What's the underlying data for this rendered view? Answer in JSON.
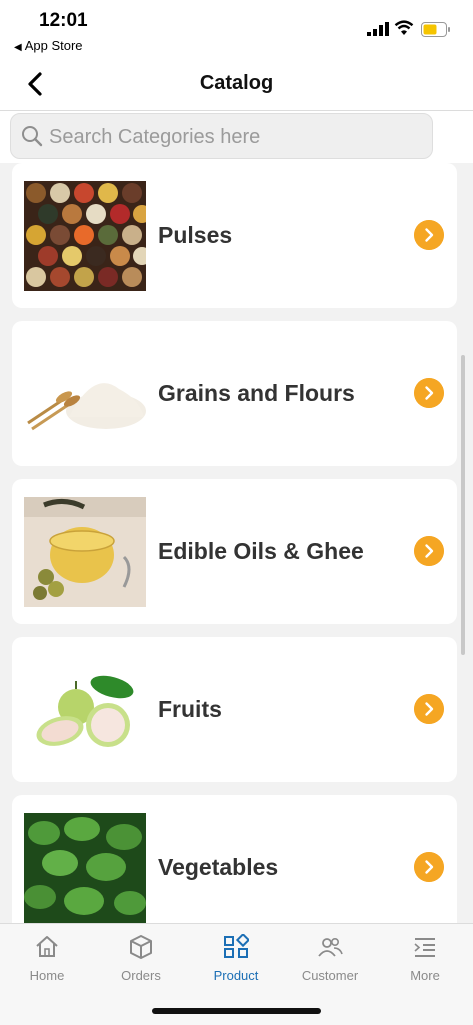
{
  "status": {
    "time": "12:01",
    "back_app": "App Store"
  },
  "nav": {
    "title": "Catalog"
  },
  "search": {
    "placeholder": "Search Categories here"
  },
  "categories": [
    {
      "label": "Pulses",
      "image": "pulses-image"
    },
    {
      "label": "Grains and Flours",
      "image": "grains-image"
    },
    {
      "label": "Edible Oils & Ghee",
      "image": "oils-image"
    },
    {
      "label": "Fruits",
      "image": "fruits-image"
    },
    {
      "label": "Vegetables",
      "image": "vegetables-image"
    }
  ],
  "tabs": [
    {
      "label": "Home",
      "icon": "home-icon",
      "active": false
    },
    {
      "label": "Orders",
      "icon": "box-icon",
      "active": false
    },
    {
      "label": "Product",
      "icon": "grid-icon",
      "active": true
    },
    {
      "label": "Customer",
      "icon": "users-icon",
      "active": false
    },
    {
      "label": "More",
      "icon": "menu-icon",
      "active": false
    }
  ],
  "colors": {
    "accent": "#f5a623",
    "active_tab": "#1c6fb5",
    "inactive_tab": "#8a8a8a"
  }
}
